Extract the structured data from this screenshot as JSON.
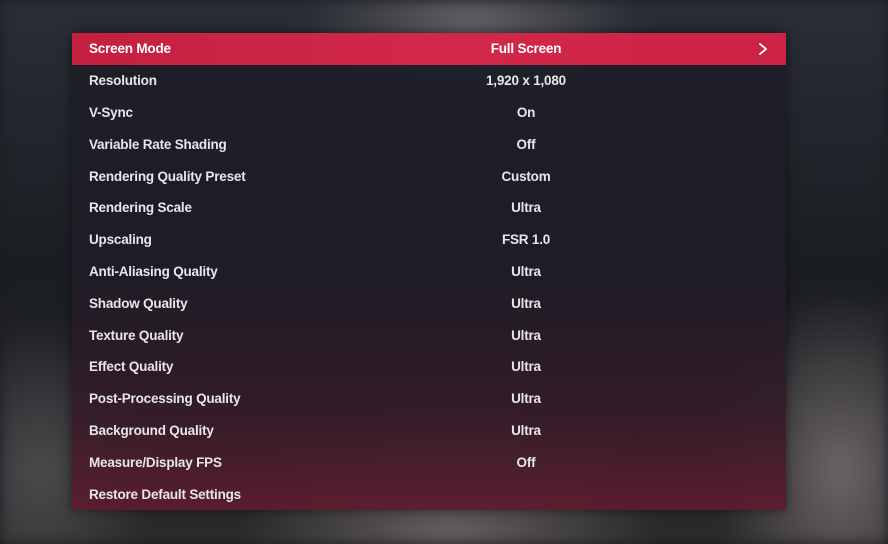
{
  "settings": [
    {
      "label": "Screen Mode",
      "value": "Full Screen",
      "selected": true
    },
    {
      "label": "Resolution",
      "value": "1,920 x 1,080"
    },
    {
      "label": "V-Sync",
      "value": "On"
    },
    {
      "label": "Variable Rate Shading",
      "value": "Off"
    },
    {
      "label": "Rendering Quality Preset",
      "value": "Custom"
    },
    {
      "label": "Rendering Scale",
      "value": "Ultra"
    },
    {
      "label": "Upscaling",
      "value": "FSR 1.0"
    },
    {
      "label": "Anti-Aliasing Quality",
      "value": "Ultra"
    },
    {
      "label": "Shadow Quality",
      "value": "Ultra"
    },
    {
      "label": "Texture Quality",
      "value": "Ultra"
    },
    {
      "label": "Effect Quality",
      "value": "Ultra"
    },
    {
      "label": "Post-Processing Quality",
      "value": "Ultra"
    },
    {
      "label": "Background Quality",
      "value": "Ultra"
    },
    {
      "label": "Measure/Display FPS",
      "value": "Off"
    },
    {
      "label": "Restore Default Settings",
      "value": ""
    }
  ],
  "icons": {
    "selected_row_arrow": "chevron-right-icon"
  },
  "colors": {
    "highlight": "#cc2244",
    "text": "#e8e6ea"
  }
}
